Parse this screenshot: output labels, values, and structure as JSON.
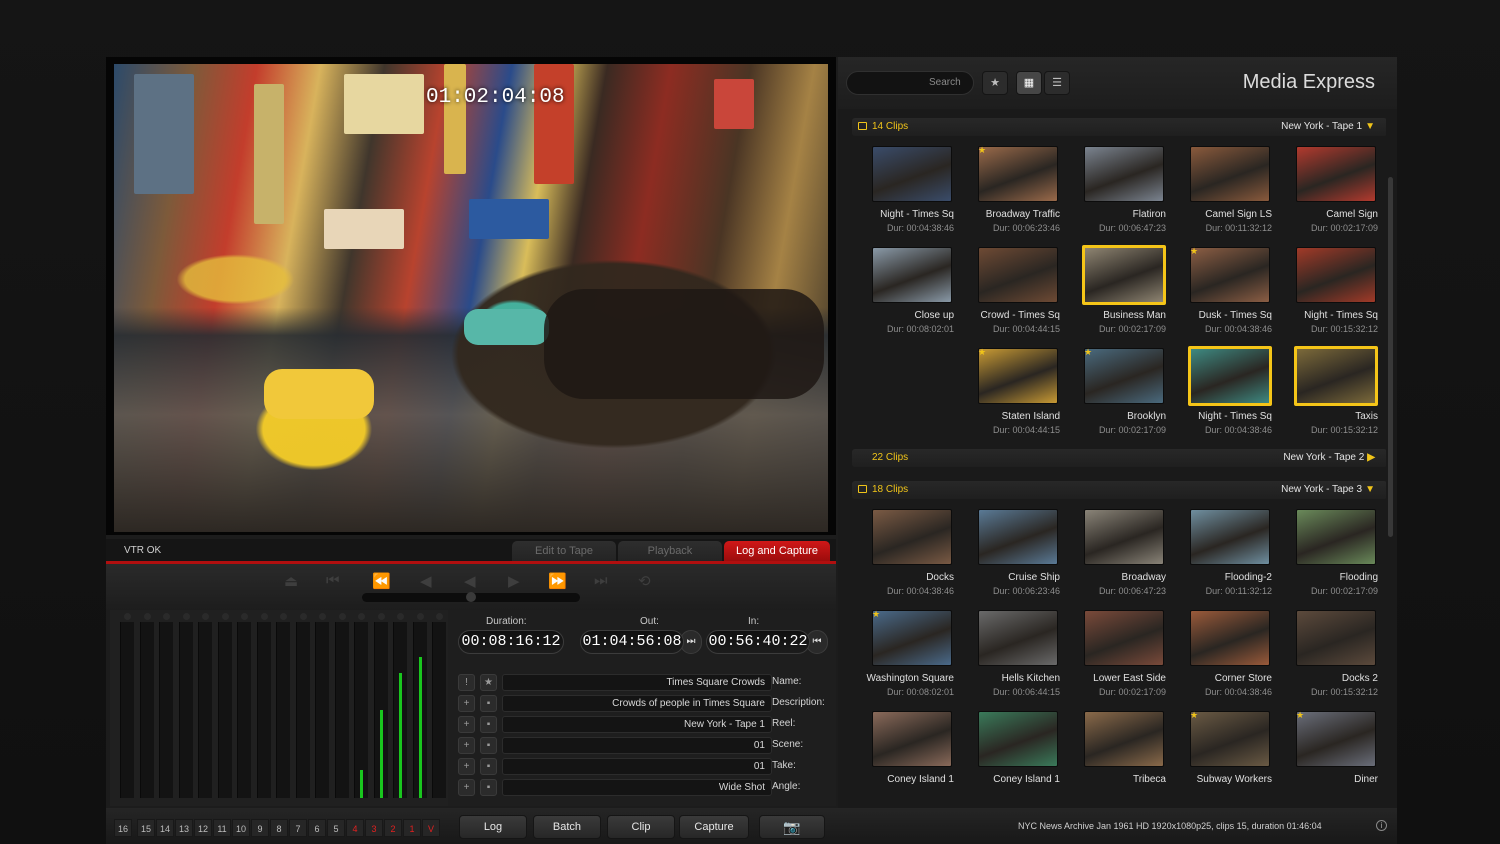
{
  "app_title": "Media Express",
  "search": {
    "placeholder": "Search"
  },
  "view_controls": {
    "favorites_icon": "star-icon",
    "grid_icon": "grid-icon",
    "list_icon": "list-icon"
  },
  "viewer": {
    "timecode": "01:02:04:08",
    "vtr_status": "VTR OK"
  },
  "tabs": [
    {
      "label": "Log and Capture",
      "active": true
    },
    {
      "label": "Playback",
      "active": false
    },
    {
      "label": "Edit to Tape",
      "active": false
    }
  ],
  "timecodes": {
    "in_label": "In:",
    "in_value": "00:56:40:22",
    "out_label": "Out:",
    "out_value": "01:04:56:08",
    "duration_label": "Duration:",
    "duration_value": "00:08:16:12"
  },
  "fields": [
    {
      "label": "Name:",
      "value": "Times Square Crowds"
    },
    {
      "label": "Description:",
      "value": "Crowds of people in Times Square"
    },
    {
      "label": "Reel:",
      "value": "New York - Tape 1"
    },
    {
      "label": "Scene:",
      "value": "01"
    },
    {
      "label": "Take:",
      "value": "01"
    },
    {
      "label": "Angle:",
      "value": "Wide Shot"
    }
  ],
  "meter_levels": [
    0,
    0,
    0,
    0,
    0,
    0,
    0,
    0,
    0,
    0,
    0,
    0,
    0.16,
    0.5,
    0.71,
    0.8,
    0
  ],
  "audio_channels": [
    "V",
    "1",
    "2",
    "3",
    "4",
    "5",
    "6",
    "7",
    "8",
    "9",
    "10",
    "11",
    "12",
    "13",
    "14",
    "15",
    "16"
  ],
  "bottom_buttons": {
    "log": "Log",
    "batch": "Batch",
    "clip": "Clip",
    "capture": "Capture",
    "camera_icon": "camera-icon"
  },
  "status_text": "NYC News Archive Jan 1961  HD 1920x1080p25, clips 15, duration 01:46:04",
  "groups": [
    {
      "name": "New York - Tape 1",
      "count": "14 Clips",
      "expanded": true,
      "clips": [
        {
          "name": "Camel Sign",
          "duration": "Dur: 00:02:17:09",
          "star": false,
          "selected": false,
          "color": "#b33a2e"
        },
        {
          "name": "Camel Sign LS",
          "duration": "Dur: 00:11:32:12",
          "star": false,
          "selected": false,
          "color": "#8a5a3c"
        },
        {
          "name": "Flatiron",
          "duration": "Dur: 00:06:47:23",
          "star": false,
          "selected": false,
          "color": "#7b8490"
        },
        {
          "name": "Broadway Traffic",
          "duration": "Dur: 00:06:23:46",
          "star": true,
          "selected": false,
          "color": "#9a6a4a"
        },
        {
          "name": "Night - Times Sq",
          "duration": "Dur: 00:04:38:46",
          "star": false,
          "selected": false,
          "color": "#3a4c6a"
        },
        {
          "name": "Night - Times Sq",
          "duration": "Dur: 00:15:32:12",
          "star": false,
          "selected": false,
          "color": "#a23a28"
        },
        {
          "name": "Dusk - Times Sq",
          "duration": "Dur: 00:04:38:46",
          "star": true,
          "selected": false,
          "color": "#8c5e44"
        },
        {
          "name": "Business Man",
          "duration": "Dur: 00:02:17:09",
          "star": false,
          "selected": true,
          "color": "#8f8572"
        },
        {
          "name": "Crowd - Times Sq",
          "duration": "Dur: 00:04:44:15",
          "star": false,
          "selected": false,
          "color": "#6e4a34"
        },
        {
          "name": "Close up",
          "duration": "Dur: 00:08:02:01",
          "star": false,
          "selected": false,
          "color": "#8a9aa8"
        },
        {
          "name": "Taxis",
          "duration": "Dur: 00:15:32:12",
          "star": false,
          "selected": true,
          "color": "#7c6a3a"
        },
        {
          "name": "Night - Times Sq",
          "duration": "Dur: 00:04:38:46",
          "star": false,
          "selected": true,
          "color": "#3e8a82"
        },
        {
          "name": "Brooklyn",
          "duration": "Dur: 00:02:17:09",
          "star": true,
          "selected": false,
          "color": "#4a6a7e"
        },
        {
          "name": "Staten Island",
          "duration": "Dur: 00:04:44:15",
          "star": true,
          "selected": false,
          "color": "#c89a34"
        }
      ]
    },
    {
      "name": "New York - Tape 2",
      "count": "22 Clips",
      "expanded": false,
      "clips": []
    },
    {
      "name": "New York - Tape 3",
      "count": "18 Clips",
      "expanded": true,
      "clips": [
        {
          "name": "Flooding",
          "duration": "Dur: 00:02:17:09",
          "star": false,
          "selected": false,
          "color": "#6a8a5a"
        },
        {
          "name": "Flooding-2",
          "duration": "Dur: 00:11:32:12",
          "star": false,
          "selected": false,
          "color": "#6f8fa0"
        },
        {
          "name": "Broadway",
          "duration": "Dur: 00:06:47:23",
          "star": false,
          "selected": false,
          "color": "#8a8478"
        },
        {
          "name": "Cruise Ship",
          "duration": "Dur: 00:06:23:46",
          "star": false,
          "selected": false,
          "color": "#5a7a96"
        },
        {
          "name": "Docks",
          "duration": "Dur: 00:04:38:46",
          "star": false,
          "selected": false,
          "color": "#7a5a44"
        },
        {
          "name": "Docks 2",
          "duration": "Dur: 00:15:32:12",
          "star": false,
          "selected": false,
          "color": "#5c4a3c"
        },
        {
          "name": "Corner Store",
          "duration": "Dur: 00:04:38:46",
          "star": false,
          "selected": false,
          "color": "#9a5a3a"
        },
        {
          "name": "Lower East Side",
          "duration": "Dur: 00:02:17:09",
          "star": false,
          "selected": false,
          "color": "#7a4a3a"
        },
        {
          "name": "Hells Kitchen",
          "duration": "Dur: 00:06:44:15",
          "star": false,
          "selected": false,
          "color": "#6a6a6a"
        },
        {
          "name": "Washington Square",
          "duration": "Dur: 00:08:02:01",
          "star": true,
          "selected": false,
          "color": "#4a6a8a"
        },
        {
          "name": "Diner",
          "duration": "",
          "star": true,
          "selected": false,
          "color": "#6a6e7a"
        },
        {
          "name": "Subway Workers",
          "duration": "",
          "star": true,
          "selected": false,
          "color": "#6a5a44"
        },
        {
          "name": "Tribeca",
          "duration": "",
          "star": false,
          "selected": false,
          "color": "#8a6a4a"
        },
        {
          "name": "Coney Island 1",
          "duration": "",
          "star": false,
          "selected": false,
          "color": "#3a7a5a"
        },
        {
          "name": "Coney Island 1",
          "duration": "",
          "star": false,
          "selected": false,
          "color": "#8a6a5a"
        }
      ]
    }
  ]
}
